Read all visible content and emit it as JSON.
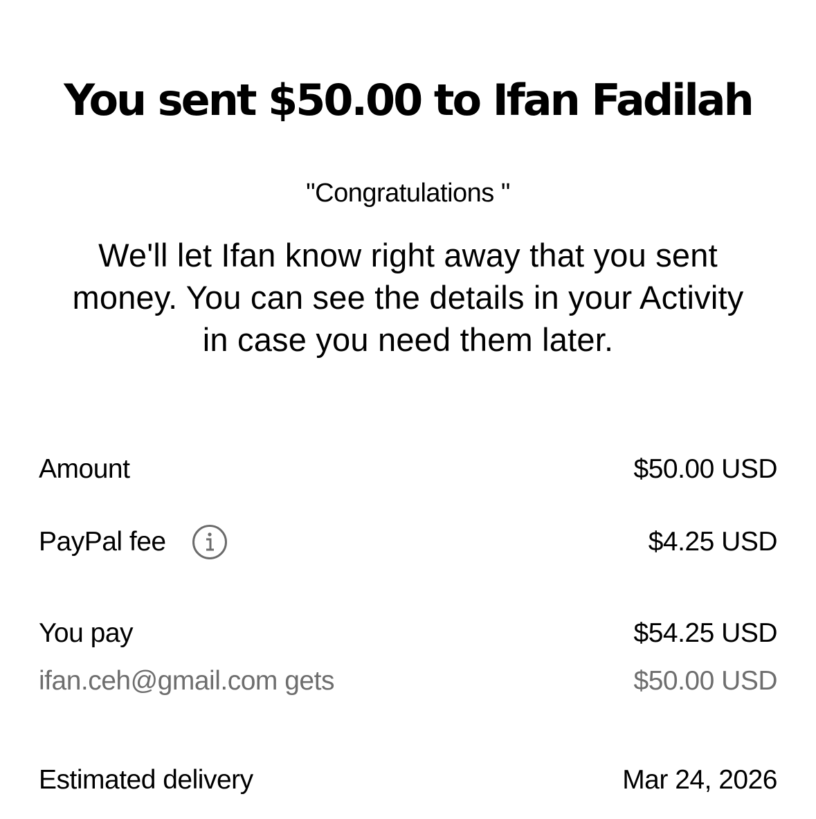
{
  "header": {
    "title": "You sent $50.00 to Ifan Fadilah"
  },
  "note": "\"Congratulations \"",
  "message": "We'll let Ifan know right away that you sent money. You can see the details in your Activity in case you need them later.",
  "details": {
    "amount": {
      "label": "Amount",
      "value": "$50.00 USD"
    },
    "fee": {
      "label": "PayPal fee",
      "value": "$4.25 USD",
      "icon": "info-icon"
    },
    "you_pay": {
      "label": "You pay",
      "value": "$54.25 USD"
    },
    "recipient_gets": {
      "label": "ifan.ceh@gmail.com gets",
      "value": "$50.00 USD"
    },
    "delivery": {
      "label": "Estimated delivery",
      "value": "Mar 24, 2026"
    }
  },
  "colors": {
    "text": "#000000",
    "muted": "#6e6e6e",
    "icon": "#6b6b6b",
    "background": "#ffffff"
  }
}
